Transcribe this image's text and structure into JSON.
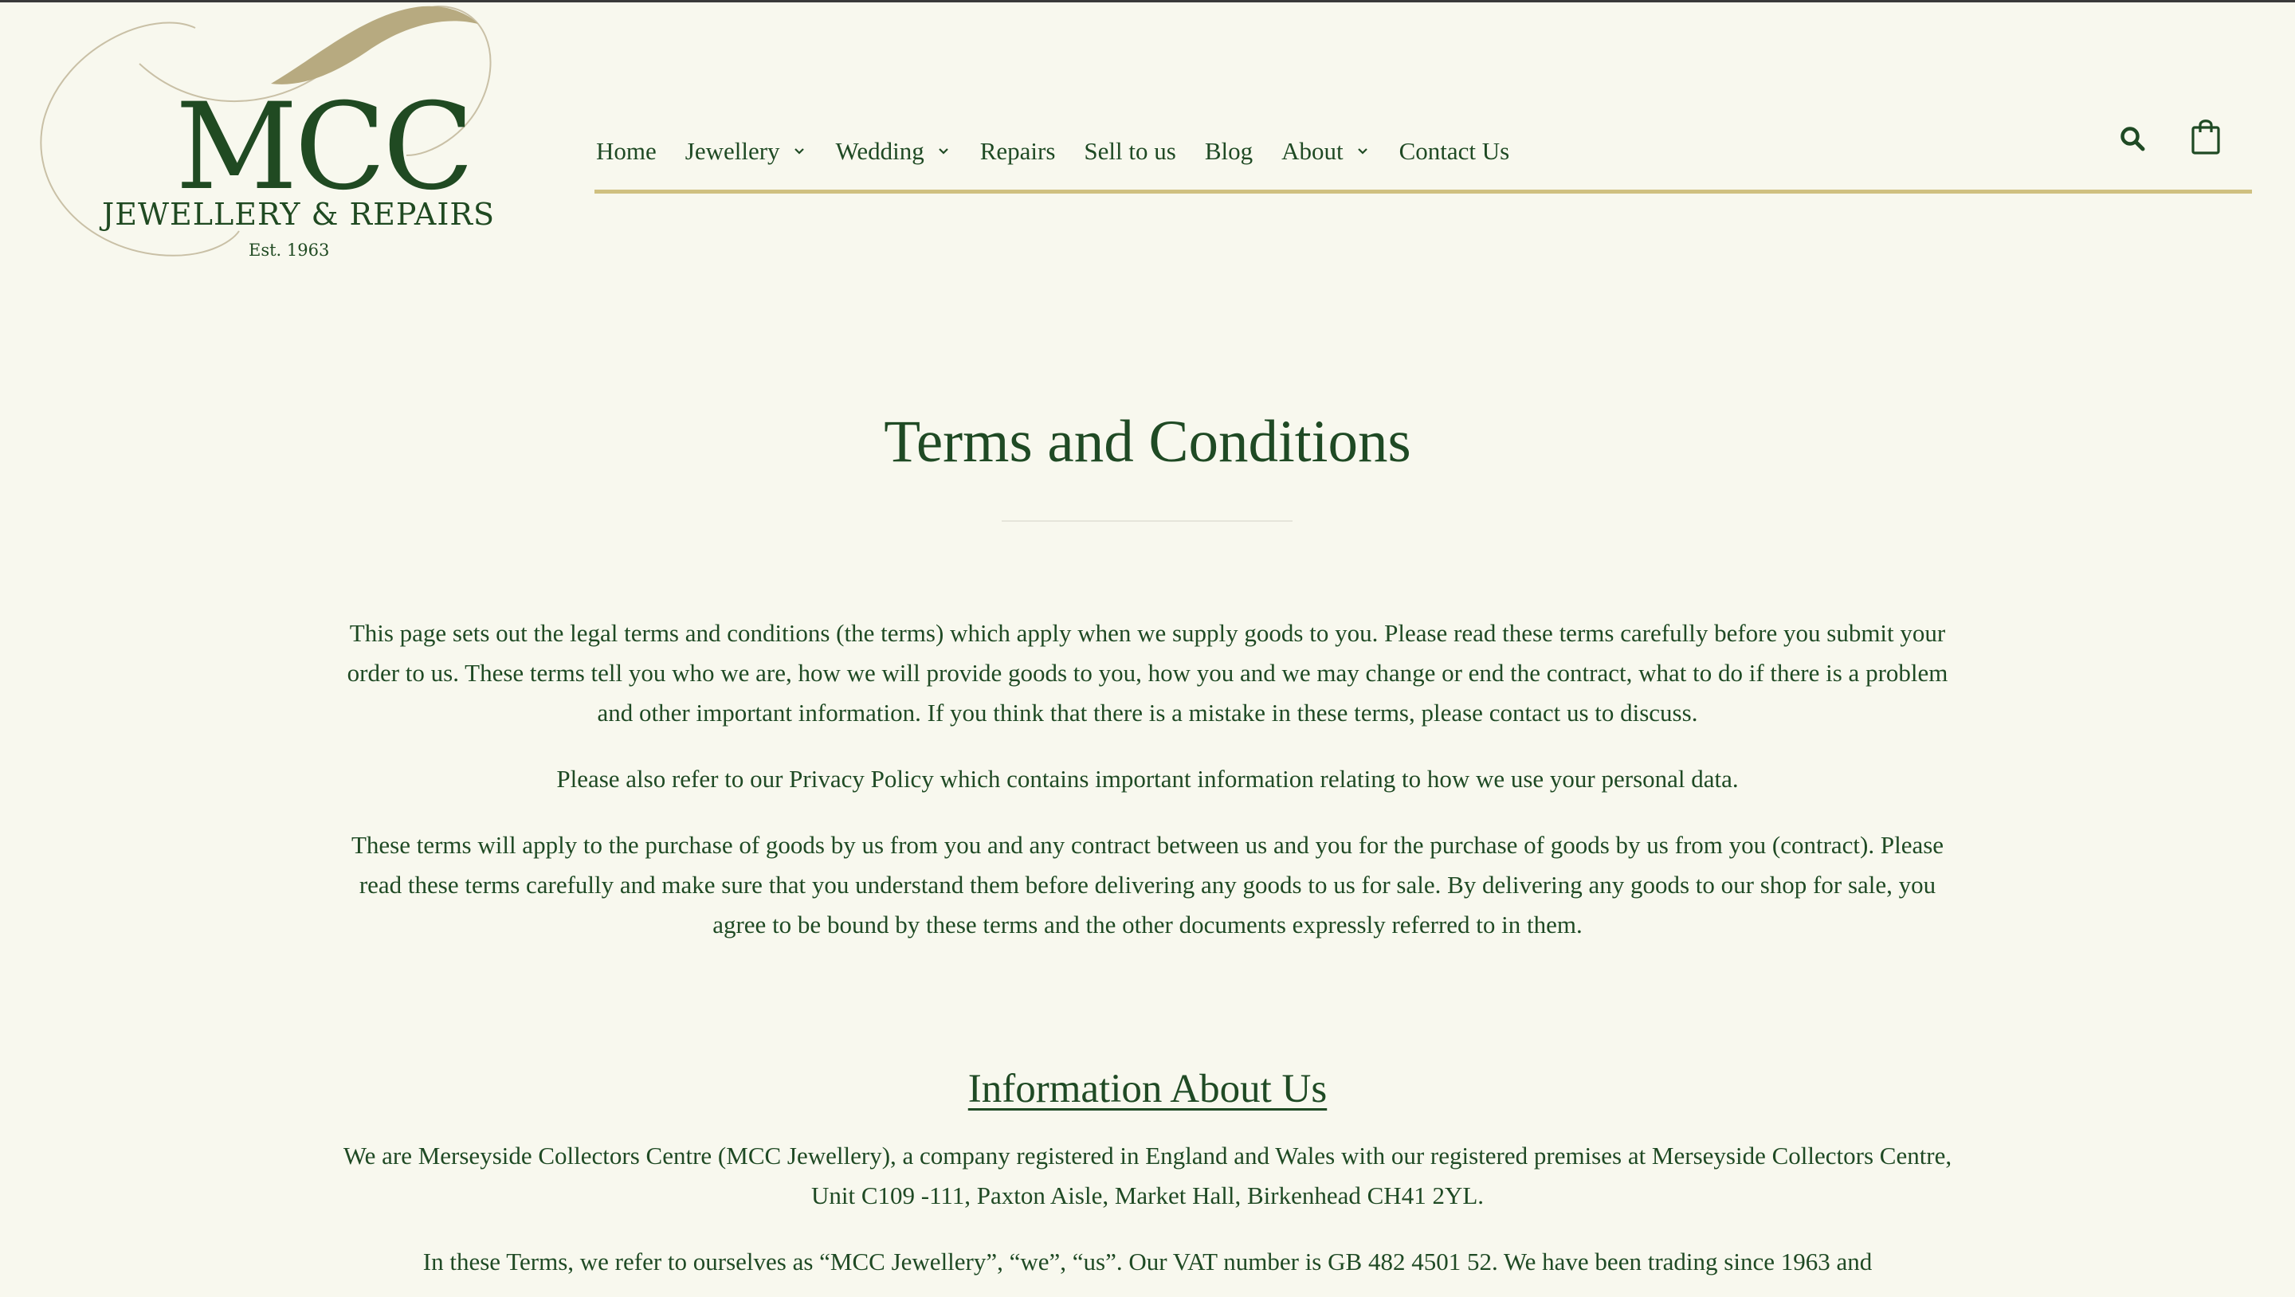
{
  "logo": {
    "mark": "MCC",
    "subtitle": "JEWELLERY & REPAIRS",
    "est": "Est. 1963"
  },
  "nav": {
    "items": [
      {
        "label": "Home",
        "has_dropdown": false
      },
      {
        "label": "Jewellery",
        "has_dropdown": true
      },
      {
        "label": "Wedding",
        "has_dropdown": true
      },
      {
        "label": "Repairs",
        "has_dropdown": false
      },
      {
        "label": "Sell to us",
        "has_dropdown": false
      },
      {
        "label": "Blog",
        "has_dropdown": false
      },
      {
        "label": "About",
        "has_dropdown": true
      },
      {
        "label": "Contact Us",
        "has_dropdown": false
      }
    ],
    "search_icon": "search-icon",
    "cart_icon": "shopping-bag-icon"
  },
  "colors": {
    "background": "#f8f8ee",
    "text": "#1f4a24",
    "accent": "#cfc080"
  },
  "page": {
    "title": "Terms and Conditions",
    "intro": [
      "This page sets out the legal terms and conditions (the terms) which apply when we supply goods to you. Please read these terms carefully before you submit your order to us. These terms tell you who we are, how we will provide goods to you, how you and we may change or end the contract, what to do if there is a problem and other important information. If you think that there is a mistake in these terms, please contact us to discuss.",
      "Please also refer to our Privacy Policy which contains important information relating to how we use your personal data.",
      "These terms will apply to the purchase of goods by us from you and any contract between us and you for the purchase of goods by us from you (contract). Please read these terms carefully and make sure that you understand them before delivering any goods to us for sale. By delivering any goods to our shop for sale, you agree to be bound by these terms and the other documents expressly referred to in them."
    ],
    "section_heading": "Information About Us",
    "section_paragraphs": [
      "We are Merseyside Collectors Centre (MCC Jewellery), a company registered in England and Wales with our registered premises at Merseyside Collectors Centre, Unit C109 -111, Paxton Aisle, Market Hall, Birkenhead CH41 2YL.",
      "In these Terms, we refer to ourselves as “MCC Jewellery”, “we”, “us”. Our VAT number is GB 482 4501 52. We have been trading since 1963 and"
    ]
  }
}
